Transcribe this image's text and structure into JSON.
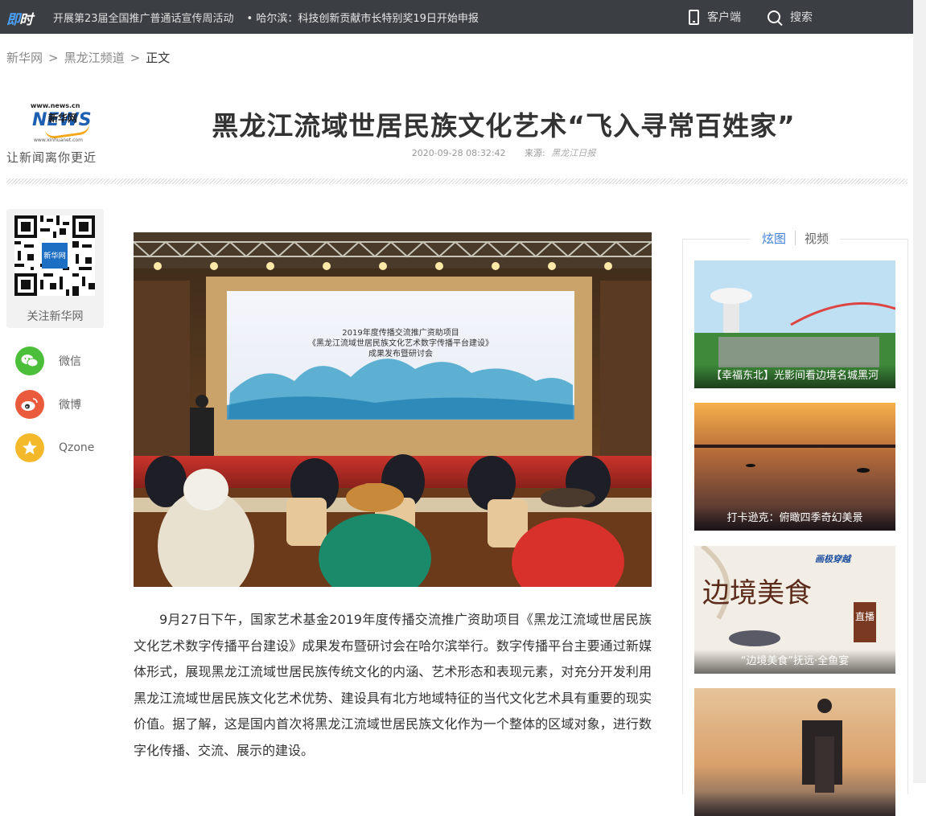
{
  "topbar": {
    "logo_a": "即",
    "logo_b": "时",
    "ticker_1": "开展第23届全国推广普通话宣传周活动",
    "ticker_2": "• 哈尔滨：科技创新贡献市长特别奖19日开始申报",
    "client_label": "客户端",
    "search_label": "搜索"
  },
  "breadcrumb": {
    "home": "新华网",
    "sep1": ">",
    "channel": "黑龙江频道",
    "sep2": ">",
    "current": "正文"
  },
  "header": {
    "logo_url": "www.news.cn",
    "logo_cn": "新华网",
    "logo_news": "NEWS",
    "logo_small": "www.xinhuanet.com",
    "slogan": "让新闻离你更近"
  },
  "article": {
    "title": "黑龙江流域世居民族文化艺术“飞入寻常百姓家”",
    "datetime": "2020-09-28 08:32:42",
    "source_label": "来源:",
    "source": "黑龙江日报",
    "paragraph": "9月27日下午，国家艺术基金2019年度传播交流推广资助项目《黑龙江流域世居民族文化艺术数字传播平台建设》成果发布暨研讨会在哈尔滨举行。数字传播平台主要通过新媒体形式，展现黑龙江流域世居民族传统文化的内涵、艺术形态和表现元素，对充分开发利用黑龙江流域世居民族文化艺术优势、建设具有北方地域特征的当代文化艺术具有重要的现实价值。据了解，这是国内首次将黑龙江流域世居民族文化作为一个整体的区域对象，进行数字化传播、交流、展示的建设。"
  },
  "photo_screen": {
    "line1": "2019年度传播交流推广资助项目",
    "line2": "《黑龙江流域世居民族文化艺术数字传播平台建设》",
    "line3": "成果发布暨研讨会"
  },
  "social": {
    "qr_label": "关注新华网",
    "qr_center": "新华网",
    "wechat": "微信",
    "weibo": "微博",
    "qzone": "Qzone"
  },
  "right_panel": {
    "tab_active": "炫图",
    "tab_other": "视频",
    "cards": [
      {
        "caption": "【幸福东北】光影间看边境名城黑河"
      },
      {
        "caption": "打卡逊克：俯瞰四季奇幻美景"
      },
      {
        "caption": "“边境美食”抚远·全鱼宴",
        "poster_big": "边境美食",
        "poster_tag": "直播",
        "poster_brand": "画极穿越"
      },
      {
        "caption": ""
      }
    ]
  }
}
